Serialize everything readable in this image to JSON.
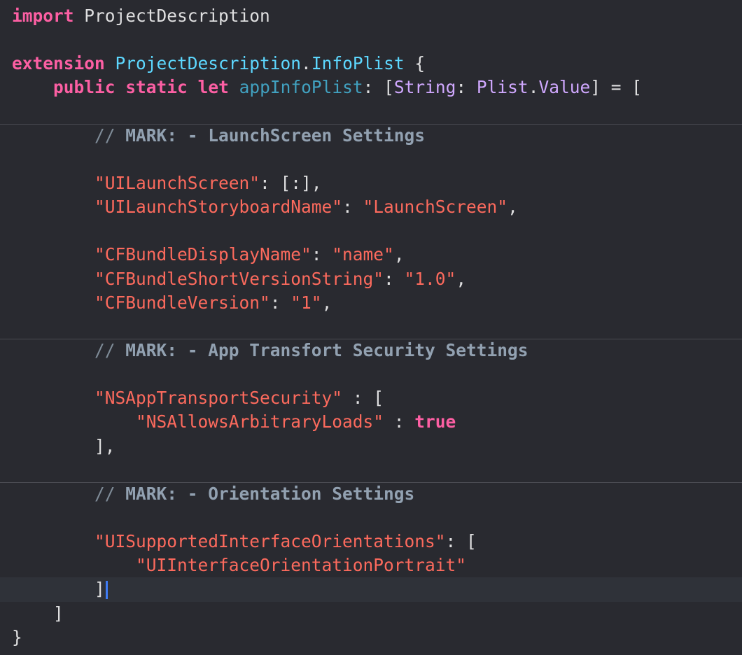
{
  "code": {
    "l1": {
      "kw": "import",
      "name": "ProjectDescription"
    },
    "l3": {
      "kw": "extension",
      "type": "ProjectDescription",
      "dot": ".",
      "type2": "InfoPlist",
      "brace": " {"
    },
    "l4": {
      "kw1": "public",
      "kw2": "static",
      "kw3": "let",
      "name": "appInfoPlist",
      "colon": ": [",
      "type1": "String",
      "colon2": ": ",
      "type2": "Plist",
      "dot": ".",
      "type3": "Value",
      "rest": "] = ["
    },
    "mark1": {
      "slashes": "//",
      "text": "MARK: - LaunchScreen Settings"
    },
    "l_launch1": {
      "key": "\"UILaunchScreen\"",
      "rest": ": [:],"
    },
    "l_launch2": {
      "key": "\"UILaunchStoryboardName\"",
      "sep": ": ",
      "val": "\"LaunchScreen\"",
      "end": ","
    },
    "l_cf1": {
      "key": "\"CFBundleDisplayName\"",
      "sep": ": ",
      "val": "\"name\"",
      "end": ","
    },
    "l_cf2": {
      "key": "\"CFBundleShortVersionString\"",
      "sep": ": ",
      "val": "\"1.0\"",
      "end": ","
    },
    "l_cf3": {
      "key": "\"CFBundleVersion\"",
      "sep": ": ",
      "val": "\"1\"",
      "end": ","
    },
    "mark2": {
      "slashes": "//",
      "text": "MARK: - App Transfort Security Settings"
    },
    "l_ats1": {
      "key": "\"NSAppTransportSecurity\"",
      "rest": " : ["
    },
    "l_ats2": {
      "key": "\"NSAllowsArbitraryLoads\"",
      "sep": " : ",
      "val": "true"
    },
    "l_ats3": {
      "text": "],"
    },
    "mark3": {
      "slashes": "//",
      "text": "MARK: - Orientation Settings"
    },
    "l_or1": {
      "key": "\"UISupportedInterfaceOrientations\"",
      "rest": ": ["
    },
    "l_or2": {
      "val": "\"UIInterfaceOrientationPortrait\""
    },
    "l_or3": {
      "text": "]"
    },
    "l_close1": {
      "text": "]"
    },
    "l_close2": {
      "text": "}"
    }
  },
  "colors": {
    "background": "#292a30",
    "keyword": "#fc5fa3",
    "type": "#5dd8ff",
    "string": "#fc6a5d",
    "comment": "#7f8c98",
    "cursor": "#3f7cf5"
  }
}
